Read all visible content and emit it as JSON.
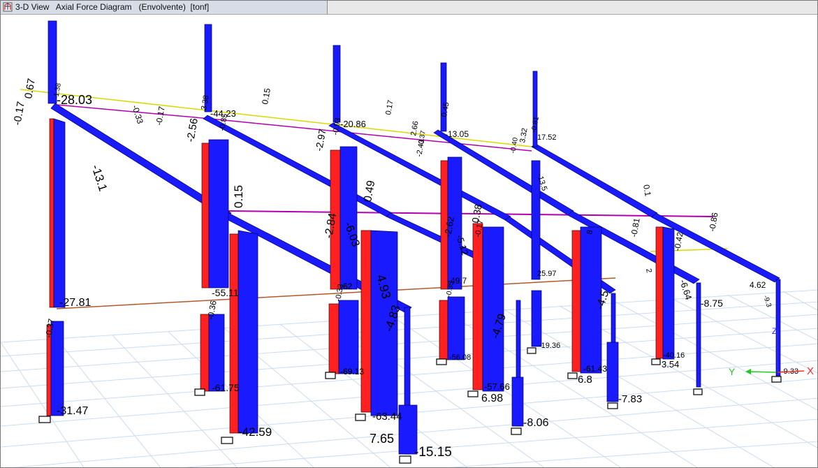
{
  "window": {
    "title": "3-D View   Axial Force Diagram   (Envolvente)  [tonf]"
  },
  "axes": {
    "x_label": "X",
    "y_label": "Y",
    "z_label": "Z",
    "x_color": "#ff2a2a",
    "y_color": "#22c922",
    "z_color": "#2a2aff"
  },
  "colors": {
    "compression": "#1a1aff",
    "tension": "#ff2020",
    "grid": "#c9dcf2",
    "tie_top": "#d9d900",
    "tie_mid": "#b000b0",
    "tie_low": "#b05a2a"
  },
  "labels": {
    "c1_top_a": "-0.17",
    "c1_top_b": "0.67",
    "c1_top_c": "-1.38",
    "c1_top_d": "-28.03",
    "c1_mid_a": "-27.81",
    "c1_mid_b": "-0.37",
    "c1_base": "-31.47",
    "r1_left": "-13.1",
    "top_a": "-0.33",
    "top_b": "-0.17",
    "top_c": "0.15",
    "top_d": "0.17",
    "c2_top_a": "-2.56",
    "c2_top_b": "-44.23",
    "c2_top_c": "-0.85",
    "c2_top_d": "3.38",
    "c2_mid_a": "0.15",
    "c2_mid_b": "-55.11",
    "c2_mid_c": "-0.36",
    "c2_low": "-61.75",
    "c2_base": "-42.59",
    "c3_top_a": "-2.97",
    "c3_top_b": "-20.86",
    "c3_top_c": "-0.93",
    "c3_mid_a": "-2.84",
    "c3_mid_b": "-6.03",
    "c3_mid_c": "0.49",
    "c3_mid_d": "-62",
    "c3_mid_e": "-0.33",
    "c3_mid_f": "4.93",
    "c3_low": "-69.13",
    "c3_low_b": "-63.44",
    "c3_base": "7.65",
    "c3_diag": "-4.83",
    "c3_foot": "-15.15",
    "c4_top_a": "2.66",
    "c4_top_b": "-2.43",
    "c4_top_c": "-13.05",
    "c4_top_d": "-0.37",
    "c4_top_e": "0.45",
    "c4_mid_a": "-2.62",
    "c4_mid_b": "-5.12",
    "c4_mid_c": "0.38",
    "c4_mid_d": "-0.17",
    "c4_mid_e": "-49.7",
    "c4_mid_f": "-0.35",
    "c4_low": "-56.08",
    "c4_low_b": "-57.66",
    "c4_base": "6.98",
    "c4_diag": "-4.79",
    "c4_foot": "-8.06",
    "c5_top_a": "3.32",
    "c5_top_b": "-0.81",
    "c5_top_c": "-0.40",
    "c5_top_d": "17.52",
    "c5_mid_a": "-13.5",
    "c5_mid_b": "25.97",
    "c5_low": "-19.36",
    "c5_mid_c": "8",
    "c5_mid_d": "-4.5",
    "c5_low_b": "-61.43",
    "c5_base": "6.8",
    "c5_foot": "-7.83",
    "c6_top": "0.1",
    "c6_mid_a": "-0.81",
    "c6_mid_b": "-0.42",
    "c6_mid_c": "-6.64",
    "c6_mid_d": "-8.75",
    "c6_low": "-40.16",
    "c6_low_b": "3.54",
    "c6_mid_e": "2",
    "c7_top": "-0.86",
    "c7_mid_a": "4.62",
    "c7_mid_b": "-9.3",
    "c7_low": "-9.33"
  }
}
